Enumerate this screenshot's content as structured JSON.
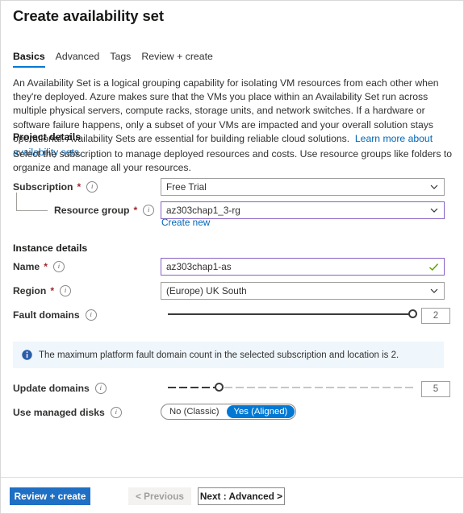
{
  "header": {
    "title": "Create availability set"
  },
  "tabs": [
    {
      "label": "Basics",
      "active": true
    },
    {
      "label": "Advanced",
      "active": false
    },
    {
      "label": "Tags",
      "active": false
    },
    {
      "label": "Review + create",
      "active": false
    }
  ],
  "intro": {
    "text": "An Availability Set is a logical grouping capability for isolating VM resources from each other when they're deployed. Azure makes sure that the VMs you place within an Availability Set run across multiple physical servers, compute racks, storage units, and network switches. If a hardware or software failure happens, only a subset of your VMs are impacted and your overall solution stays operational. Availability Sets are essential for building reliable cloud solutions.",
    "link_label": "Learn more about availability sets."
  },
  "project_details": {
    "heading": "Project details",
    "description": "Select the subscription to manage deployed resources and costs. Use resource groups like folders to organize and manage all your resources.",
    "subscription": {
      "label": "Subscription",
      "required": "*",
      "value": "Free Trial"
    },
    "resource_group": {
      "label": "Resource group",
      "required": "*",
      "value": "az303chap1_3-rg",
      "create_new_label": "Create new"
    }
  },
  "instance_details": {
    "heading": "Instance details",
    "name": {
      "label": "Name",
      "required": "*",
      "value": "az303chap1-as"
    },
    "region": {
      "label": "Region",
      "required": "*",
      "value": "(Europe) UK South"
    },
    "fault_domains": {
      "label": "Fault domains",
      "value": "2",
      "min": 1,
      "max": 2,
      "percent": 100
    },
    "update_domains": {
      "label": "Update domains",
      "value": "5",
      "min": 1,
      "max": 20,
      "percent": 21
    },
    "use_managed_disks": {
      "label": "Use managed disks",
      "options": [
        {
          "label": "No (Classic)",
          "selected": false
        },
        {
          "label": "Yes (Aligned)",
          "selected": true
        }
      ]
    }
  },
  "banner": {
    "icon": "info-icon",
    "text": "The maximum platform fault domain count in the selected subscription and location is 2."
  },
  "footer": {
    "review_create_label": "Review + create",
    "previous_label": "< Previous",
    "next_label": "Next : Advanced >"
  },
  "colors": {
    "accent": "#0078d4",
    "primary_button": "#1f6fc4",
    "link": "#0067b8",
    "required": "#a4262c",
    "focus_border": "#8661c5",
    "banner_bg": "#eff6fc",
    "success": "#5ba300"
  }
}
